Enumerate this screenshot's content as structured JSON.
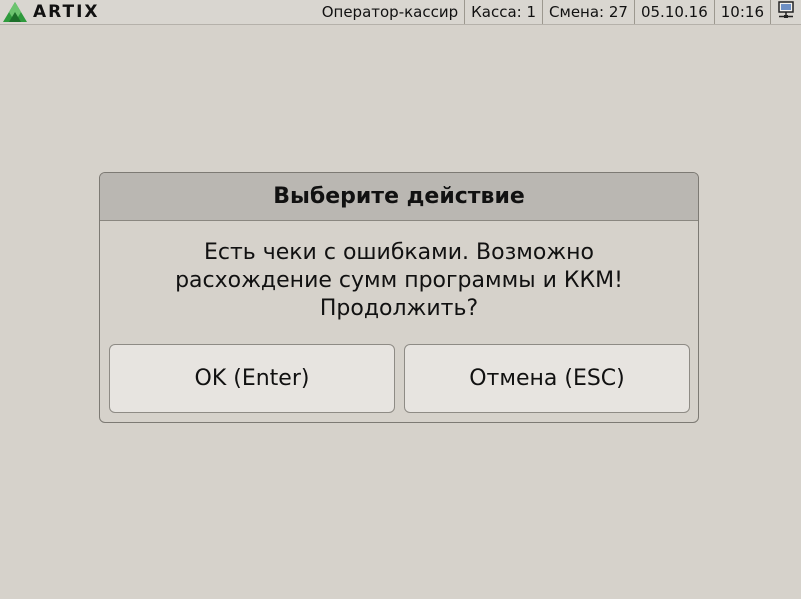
{
  "app": {
    "logo_text": "ARTIX",
    "logo_icon": "artix-triangle-logo"
  },
  "status_bar": {
    "operator": "Оператор-кассир",
    "kassa": "Касса: 1",
    "shift": "Смена: 27",
    "date": "05.10.16",
    "time": "10:16",
    "network_icon": "network-computer-icon"
  },
  "dialog": {
    "title": "Выберите действие",
    "message_lines": [
      "Есть чеки с ошибками. Возможно",
      "расхождение сумм программы и ККМ!",
      "Продолжить?"
    ],
    "ok_label": "OK (Enter)",
    "cancel_label": "Отмена (ESC)"
  },
  "colors": {
    "background": "#d6d2cb",
    "dialog_header": "#bab7b2",
    "button_face": "#e7e4e0",
    "logo_green": "#2e9a3c"
  }
}
